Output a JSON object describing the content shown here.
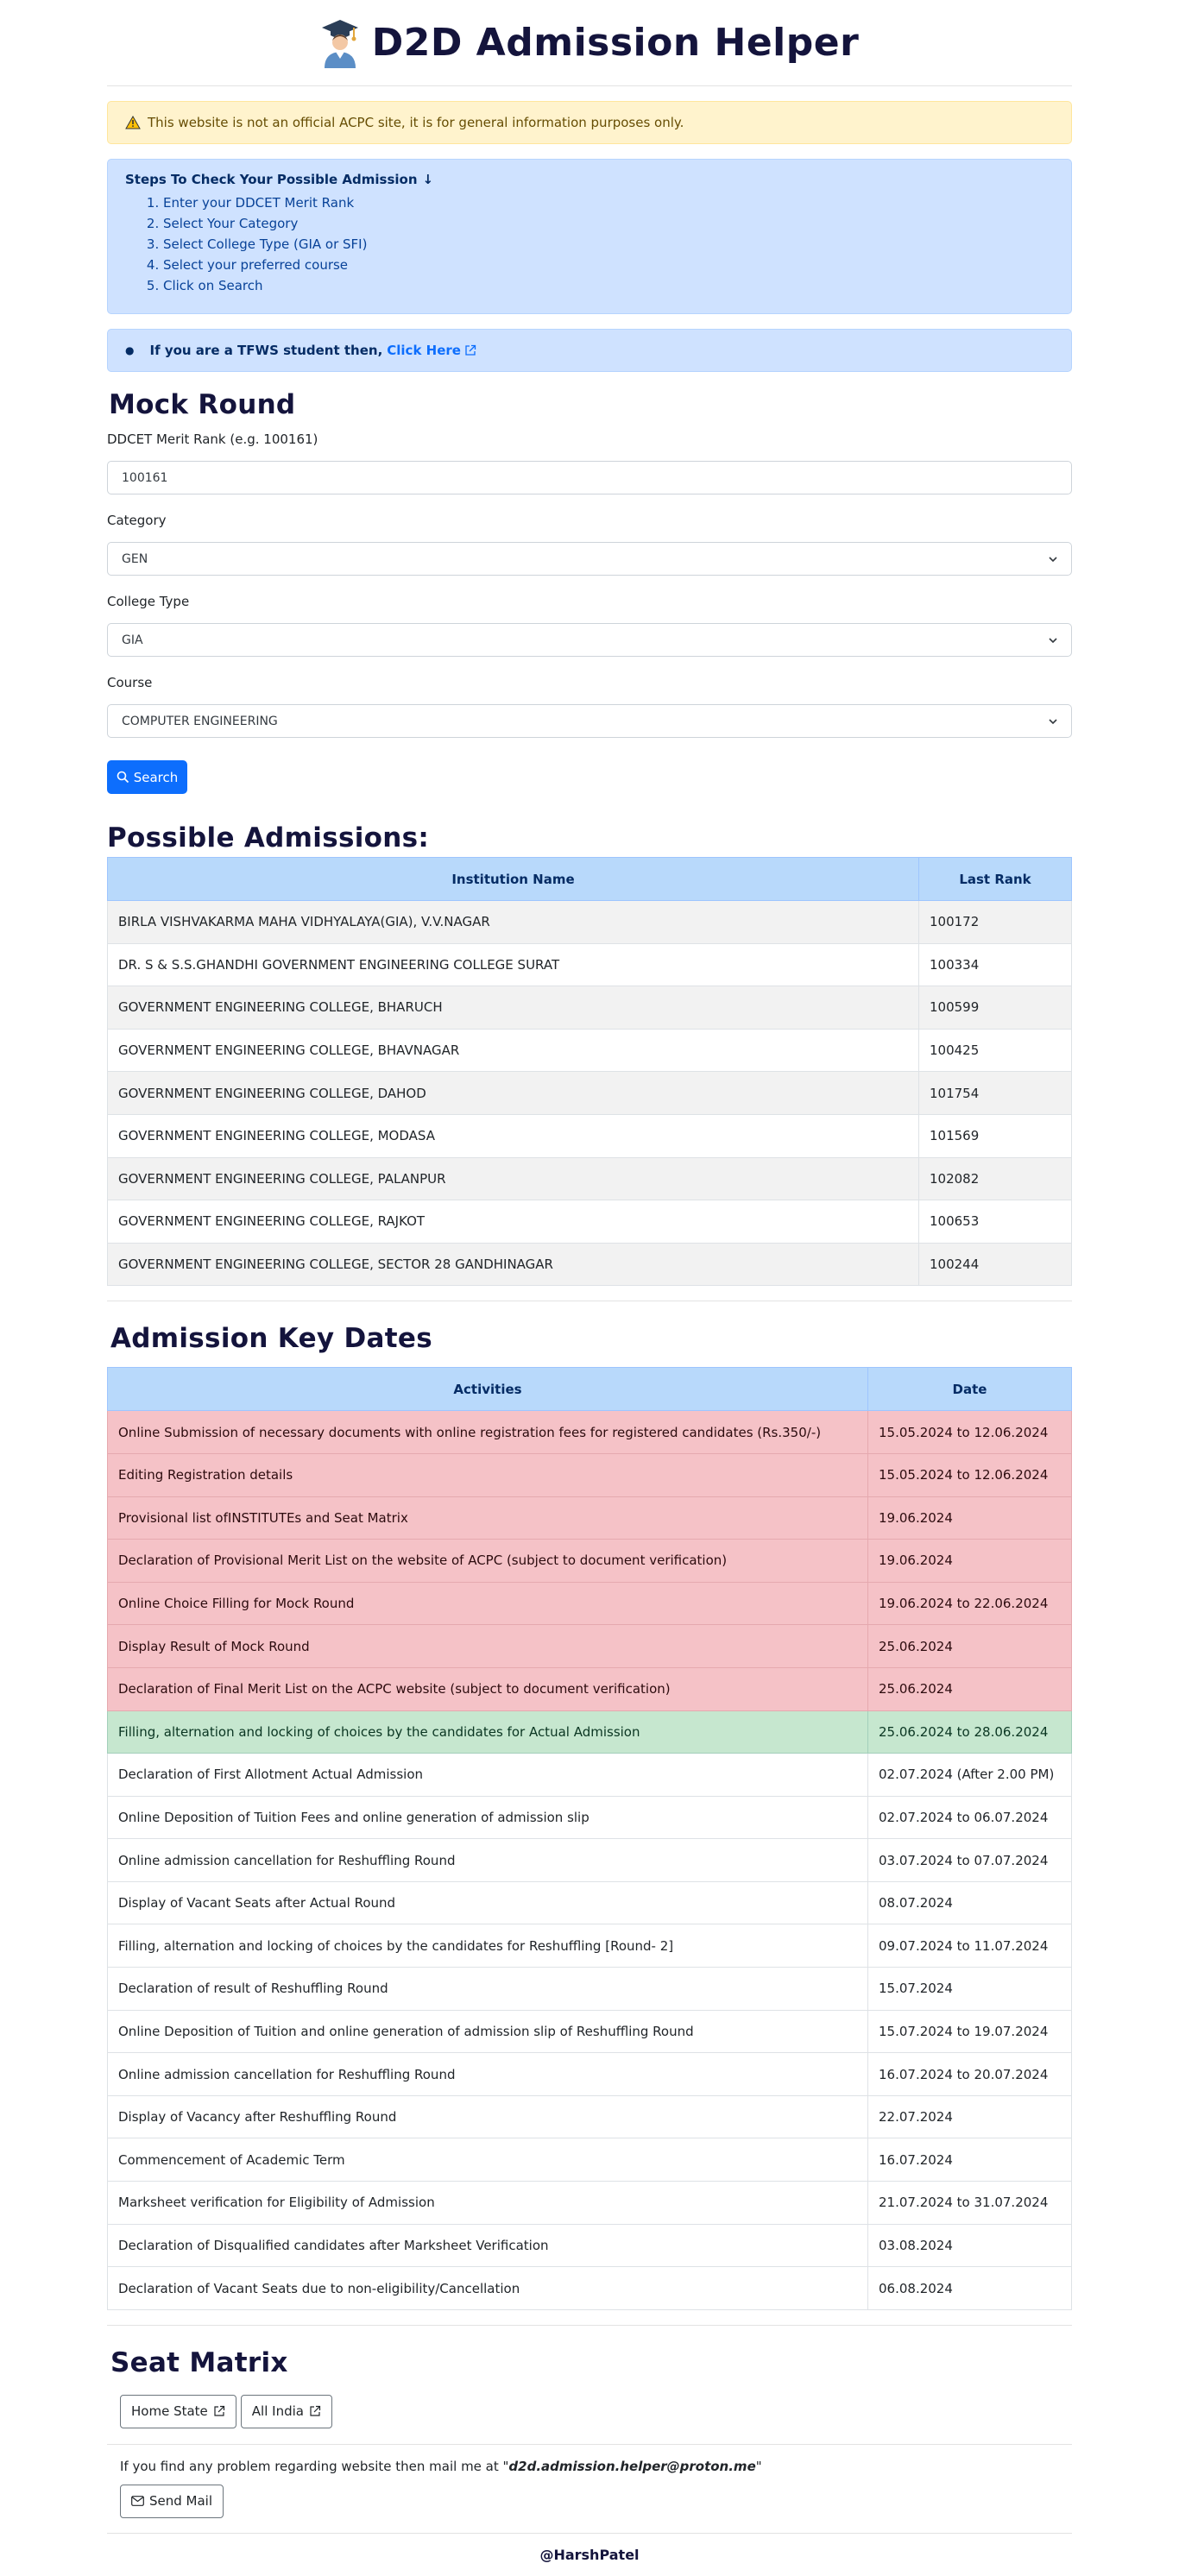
{
  "header": {
    "title": "D2D Admission Helper"
  },
  "disclaimer": "This website is not an official ACPC site, it is for general information purposes only.",
  "steps": {
    "title": "Steps To Check Your Possible Admission",
    "items": [
      "Enter your DDCET Merit Rank",
      "Select Your Category",
      "Select College Type (GIA or SFI)",
      "Select your preferred course",
      "Click on Search"
    ]
  },
  "tfws": {
    "text": "If you are a TFWS student then,",
    "link": "Click Here"
  },
  "mock": {
    "title": "Mock Round",
    "rank_label": "DDCET Merit Rank (e.g. 100161)",
    "rank_value": "100161",
    "category_label": "Category",
    "category_value": "GEN",
    "college_type_label": "College Type",
    "college_type_value": "GIA",
    "course_label": "Course",
    "course_value": "COMPUTER ENGINEERING",
    "search_label": "Search"
  },
  "possible": {
    "title": "Possible Admissions:",
    "headers": [
      "Institution Name",
      "Last Rank"
    ],
    "rows": [
      [
        "BIRLA VISHVAKARMA MAHA VIDHYALAYA(GIA), V.V.NAGAR",
        "100172"
      ],
      [
        "DR. S & S.S.GHANDHI GOVERNMENT ENGINEERING COLLEGE SURAT",
        "100334"
      ],
      [
        "GOVERNMENT ENGINEERING COLLEGE, BHARUCH",
        "100599"
      ],
      [
        "GOVERNMENT ENGINEERING COLLEGE, BHAVNAGAR",
        "100425"
      ],
      [
        "GOVERNMENT ENGINEERING COLLEGE, DAHOD",
        "101754"
      ],
      [
        "GOVERNMENT ENGINEERING COLLEGE, MODASA",
        "101569"
      ],
      [
        "GOVERNMENT ENGINEERING COLLEGE, PALANPUR",
        "102082"
      ],
      [
        "GOVERNMENT ENGINEERING COLLEGE, RAJKOT",
        "100653"
      ],
      [
        "GOVERNMENT ENGINEERING COLLEGE, SECTOR 28 GANDHINAGAR",
        "100244"
      ]
    ]
  },
  "dates": {
    "title": "Admission Key Dates",
    "headers": [
      "Activities",
      "Date"
    ],
    "rows": [
      {
        "activity": "Online Submission of necessary documents with online registration fees for registered candidates (Rs.350/-)",
        "date": "15.05.2024 to 12.06.2024",
        "status": "danger"
      },
      {
        "activity": "Editing Registration details",
        "date": "15.05.2024 to 12.06.2024",
        "status": "danger"
      },
      {
        "activity": "Provisional list ofINSTITUTEs and Seat Matrix",
        "date": "19.06.2024",
        "status": "danger"
      },
      {
        "activity": "Declaration of Provisional Merit List on the website of ACPC (subject to document verification)",
        "date": "19.06.2024",
        "status": "danger"
      },
      {
        "activity": "Online Choice Filling for Mock Round",
        "date": "19.06.2024 to 22.06.2024",
        "status": "danger"
      },
      {
        "activity": "Display Result of Mock Round",
        "date": "25.06.2024",
        "status": "danger"
      },
      {
        "activity": "Declaration of Final Merit List on the ACPC website (subject to document verification)",
        "date": "25.06.2024",
        "status": "danger"
      },
      {
        "activity": "Filling, alternation and locking of choices by the candidates for Actual Admission",
        "date": "25.06.2024 to 28.06.2024",
        "status": "success"
      },
      {
        "activity": "Declaration of First Allotment Actual Admission",
        "date": "02.07.2024 (After 2.00 PM)",
        "status": "normal"
      },
      {
        "activity": "Online Deposition of Tuition Fees and online generation of admission slip",
        "date": "02.07.2024 to 06.07.2024",
        "status": "normal"
      },
      {
        "activity": "Online admission cancellation for Reshuffling Round",
        "date": "03.07.2024 to 07.07.2024",
        "status": "normal"
      },
      {
        "activity": "Display of Vacant Seats after Actual Round",
        "date": "08.07.2024",
        "status": "normal"
      },
      {
        "activity": "Filling, alternation and locking of choices by the candidates for Reshuffling [Round- 2]",
        "date": "09.07.2024 to 11.07.2024",
        "status": "normal"
      },
      {
        "activity": "Declaration of result of Reshuffling Round",
        "date": "15.07.2024",
        "status": "normal"
      },
      {
        "activity": "Online Deposition of Tuition and online generation of admission slip of Reshuffling Round",
        "date": "15.07.2024 to 19.07.2024",
        "status": "normal"
      },
      {
        "activity": "Online admission cancellation for Reshuffling Round",
        "date": "16.07.2024 to 20.07.2024",
        "status": "normal"
      },
      {
        "activity": "Display of Vacancy after Reshuffling Round",
        "date": "22.07.2024",
        "status": "normal"
      },
      {
        "activity": "Commencement of Academic Term",
        "date": "16.07.2024",
        "status": "normal"
      },
      {
        "activity": "Marksheet verification for Eligibility of Admission",
        "date": "21.07.2024 to 31.07.2024",
        "status": "normal"
      },
      {
        "activity": "Declaration of Disqualified candidates after Marksheet Verification",
        "date": "03.08.2024",
        "status": "normal"
      },
      {
        "activity": "Declaration of Vacant Seats due to non-eligibility/Cancellation",
        "date": "06.08.2024",
        "status": "normal"
      }
    ]
  },
  "seat_matrix": {
    "title": "Seat Matrix",
    "home_state": "Home State",
    "all_india": "All India"
  },
  "contact": {
    "prefix": "If you find any problem regarding website then mail me at \"",
    "email": "d2d.admission.helper@proton.me",
    "suffix": "\"",
    "send_label": "Send Mail"
  },
  "footer": "@HarshPatel"
}
